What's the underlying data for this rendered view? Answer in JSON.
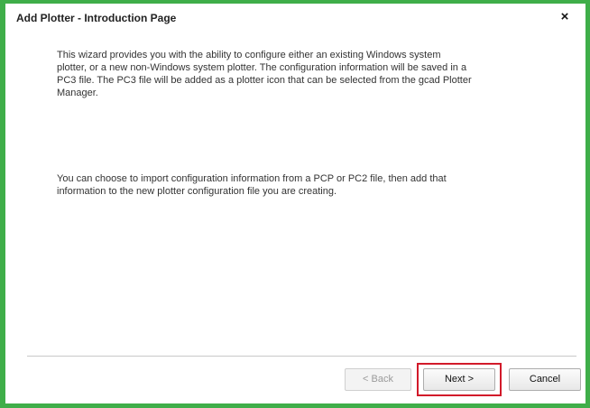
{
  "window": {
    "title": "Add Plotter - Introduction Page",
    "close_glyph": "×",
    "border_color": "#3fae49"
  },
  "content": {
    "paragraph_1": "This wizard provides you with the ability to configure either an existing Windows system plotter, or a new non-Windows system plotter. The configuration information will be saved in a PC3 file. The PC3 file will be added as a plotter icon that can be selected from the gcad Plotter Manager.",
    "paragraph_2": "You can choose to import configuration information from a PCP or PC2 file, then add that information to the new plotter configuration file you are creating."
  },
  "buttons": {
    "back_label": "< Back",
    "back_enabled": false,
    "next_label": "Next >",
    "cancel_label": "Cancel",
    "highlight_color": "#d21a2a"
  }
}
